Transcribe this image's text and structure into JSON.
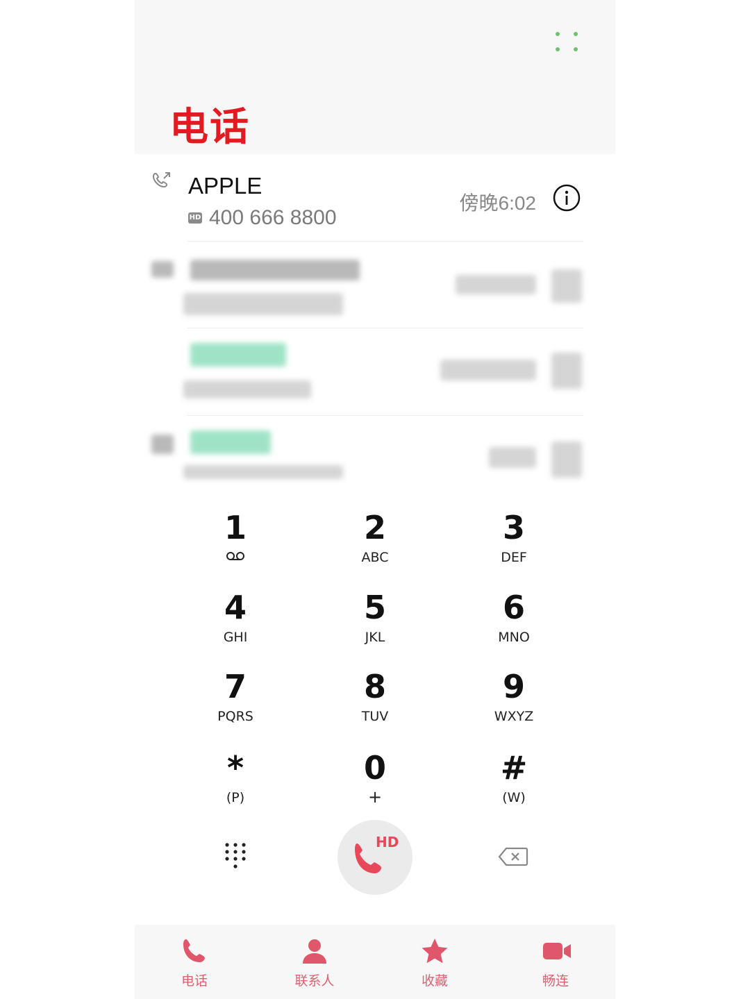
{
  "header": {
    "title": "电话",
    "more_icon": "more-dots-icon"
  },
  "recents": [
    {
      "name": "APPLE",
      "badge": "HD",
      "number": "400 666 8800",
      "time": "傍晚6:02",
      "call_icon": "outgoing-call-icon",
      "info_icon": "info-icon"
    }
  ],
  "keypad": [
    {
      "digit": "1",
      "letters": "",
      "sub_icon": "voicemail-icon"
    },
    {
      "digit": "2",
      "letters": "ABC"
    },
    {
      "digit": "3",
      "letters": "DEF"
    },
    {
      "digit": "4",
      "letters": "GHI"
    },
    {
      "digit": "5",
      "letters": "JKL"
    },
    {
      "digit": "6",
      "letters": "MNO"
    },
    {
      "digit": "7",
      "letters": "PQRS"
    },
    {
      "digit": "8",
      "letters": "TUV"
    },
    {
      "digit": "9",
      "letters": "WXYZ"
    },
    {
      "digit": "*",
      "letters": "(P)"
    },
    {
      "digit": "0",
      "letters": "+"
    },
    {
      "digit": "#",
      "letters": "(W)"
    }
  ],
  "actions": {
    "call_badge": "HD",
    "dialpad_icon": "dialpad-icon",
    "call_icon": "phone-icon",
    "backspace_icon": "backspace-icon"
  },
  "nav": [
    {
      "label": "电话",
      "icon": "phone-icon"
    },
    {
      "label": "联系人",
      "icon": "contacts-icon"
    },
    {
      "label": "收藏",
      "icon": "star-icon"
    },
    {
      "label": "畅连",
      "icon": "video-call-icon"
    }
  ],
  "colors": {
    "title_red": "#e21a22",
    "accent_pink": "#e06070",
    "more_dots_green": "#6cc36c",
    "header_bg": "#f7f7f7"
  }
}
